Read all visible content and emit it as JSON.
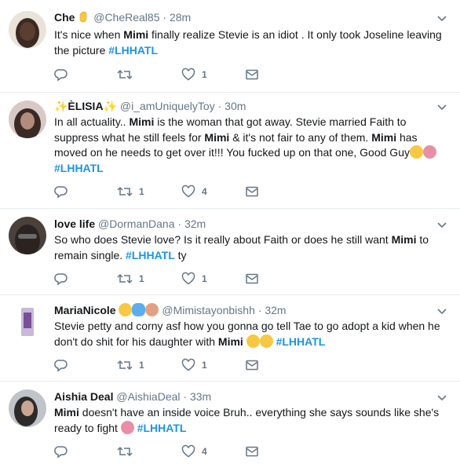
{
  "tweets": [
    {
      "name": "Che",
      "handle": "@CheReal85",
      "time": "28m",
      "text_parts": [
        {
          "t": "It's nice when "
        },
        {
          "t": "Mimi",
          "b": true
        },
        {
          "t": " finally realize Stevie is an idiot .  It only took Joseline leaving the picture "
        },
        {
          "t": "#LHHATL",
          "h": true
        }
      ],
      "replies": "",
      "retweets": "",
      "likes": "1",
      "avatar_color": "#3b2a22"
    },
    {
      "name": "✨ÈLISIA✨",
      "handle": "@i_amUniquelyToy",
      "time": "30m",
      "text_parts": [
        {
          "t": "In all actuality.. "
        },
        {
          "t": "Mimi",
          "b": true
        },
        {
          "t": " is the woman that got away. Stevie married Faith to suppress what he still feels for "
        },
        {
          "t": "Mimi",
          "b": true
        },
        {
          "t": " & it's not fair to any of them. "
        },
        {
          "t": "Mimi",
          "b": true
        },
        {
          "t": " has moved on he needs to get over it!!! You fucked up on that one, Good Guy"
        },
        {
          "e": "wink-emoji"
        },
        {
          "e": "person-gesturing-no-emoji"
        },
        {
          "t": " "
        },
        {
          "t": "#LHHATL",
          "h": true
        }
      ],
      "replies": "",
      "retweets": "1",
      "likes": "4",
      "avatar_color": "#8a6e67"
    },
    {
      "name": "love life",
      "handle": "@DormanDana",
      "time": "32m",
      "text_parts": [
        {
          "t": "So who does Stevie love? Is it really about Faith or does he still want "
        },
        {
          "t": "Mimi",
          "b": true
        },
        {
          "t": " to remain single. "
        },
        {
          "t": "#LHHATL",
          "h": true
        },
        {
          "t": " ty"
        }
      ],
      "replies": "",
      "retweets": "1",
      "likes": "1",
      "avatar_color": "#2b2320"
    },
    {
      "name": "MariaNicole",
      "handle": "@Mimistayonbishh",
      "time": "32m",
      "text_parts": [
        {
          "t": "Stevie petty and corny asf how you gonna go tell Tae to go adopt a kid when he don't do shit for his daughter with "
        },
        {
          "t": "Mimi",
          "b": true
        },
        {
          "t": " "
        },
        {
          "e": "confused-emoji"
        },
        {
          "e": "unamused-emoji"
        },
        {
          "t": " "
        },
        {
          "t": "#LHHATL",
          "h": true
        }
      ],
      "replies": "",
      "retweets": "1",
      "likes": "1",
      "avatar_color": "#c7b9d9"
    },
    {
      "name": "Aishia Deal",
      "handle": "@AishiaDeal",
      "time": "33m",
      "text_parts": [
        {
          "t": "Mimi",
          "b": true
        },
        {
          "t": " doesn't have an inside voice Bruh.. everything she says sounds like she's ready to fight "
        },
        {
          "e": "person-gesturing-no-emoji"
        },
        {
          "t": " "
        },
        {
          "t": "#LHHATL",
          "h": true
        }
      ],
      "replies": "",
      "retweets": "",
      "likes": "4",
      "avatar_color": "#9aa0a6"
    }
  ],
  "icons": {
    "reply": "reply-icon",
    "retweet": "retweet-icon",
    "like": "heart-icon",
    "message": "envelope-icon",
    "caret": "chevron-down-icon"
  },
  "colors": {
    "hashtag": "#1b95e0",
    "secondary_text": "#657786",
    "divider": "#e6ecf0"
  }
}
